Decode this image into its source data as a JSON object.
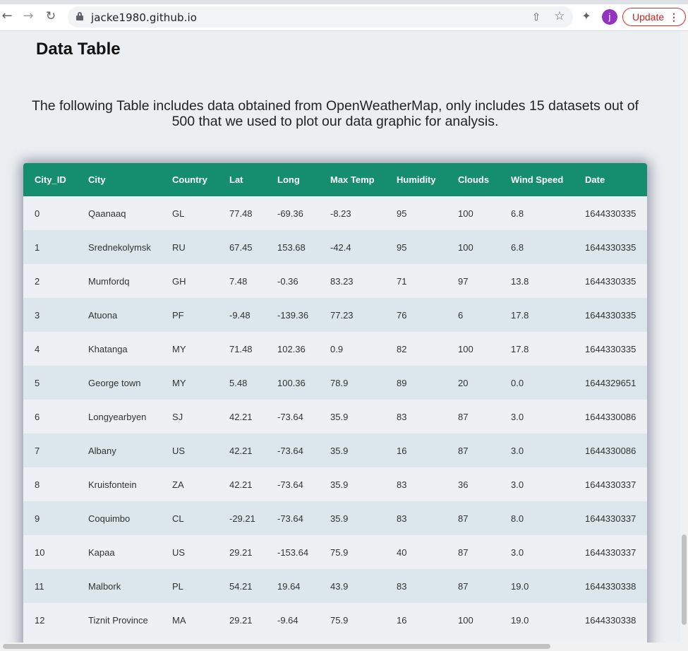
{
  "browser": {
    "url": "jacke1980.github.io",
    "update_label": "Update",
    "profile_initial": "j",
    "icons": {
      "back": "back-arrow-icon",
      "forward": "forward-arrow-icon",
      "reload": "reload-icon",
      "lock": "lock-icon",
      "share": "share-icon",
      "star": "star-icon",
      "extensions": "puzzle-icon",
      "menu": "kebab-menu-icon"
    }
  },
  "page": {
    "section_title": "Data Table",
    "intro_text": "The following Table includes data obtained from OpenWeatherMap, only includes 15 datasets out of 500 that we used to plot our data graphic for analysis."
  },
  "table": {
    "header_color": "#158e6f",
    "columns": [
      "City_ID",
      "City",
      "Country",
      "Lat",
      "Long",
      "Max Temp",
      "Humidity",
      "Clouds",
      "Wind Speed",
      "Date"
    ],
    "rows": [
      [
        "0",
        "Qaanaaq",
        "GL",
        "77.48",
        "-69.36",
        "-8.23",
        "95",
        "100",
        "6.8",
        "1644330335"
      ],
      [
        "1",
        "Srednekolymsk",
        "RU",
        "67.45",
        "153.68",
        "-42.4",
        "95",
        "100",
        "6.8",
        "1644330335"
      ],
      [
        "2",
        "Mumfordq",
        "GH",
        "7.48",
        "-0.36",
        "83.23",
        "71",
        "97",
        "13.8",
        "1644330335"
      ],
      [
        "3",
        "Atuona",
        "PF",
        "-9.48",
        "-139.36",
        "77.23",
        "76",
        "6",
        "17.8",
        "1644330335"
      ],
      [
        "4",
        "Khatanga",
        "MY",
        "71.48",
        "102.36",
        "0.9",
        "82",
        "100",
        "17.8",
        "1644330335"
      ],
      [
        "5",
        "George town",
        "MY",
        "5.48",
        "100.36",
        "78.9",
        "89",
        "20",
        "0.0",
        "1644329651"
      ],
      [
        "6",
        "Longyearbyen",
        "SJ",
        "42.21",
        "-73.64",
        "35.9",
        "83",
        "87",
        "3.0",
        "1644330086"
      ],
      [
        "7",
        "Albany",
        "US",
        "42.21",
        "-73.64",
        "35.9",
        "16",
        "87",
        "3.0",
        "1644330086"
      ],
      [
        "8",
        "Kruisfontein",
        "ZA",
        "42.21",
        "-73.64",
        "35.9",
        "83",
        "36",
        "3.0",
        "1644330337"
      ],
      [
        "9",
        "Coquimbo",
        "CL",
        "-29.21",
        "-73.64",
        "35.9",
        "83",
        "87",
        "8.0",
        "1644330337"
      ],
      [
        "10",
        "Kapaa",
        "US",
        "29.21",
        "-153.64",
        "75.9",
        "40",
        "87",
        "3.0",
        "1644330337"
      ],
      [
        "11",
        "Malbork",
        "PL",
        "54.21",
        "19.64",
        "43.9",
        "83",
        "87",
        "19.0",
        "1644330338"
      ],
      [
        "12",
        "Tiznit Province",
        "MA",
        "29.21",
        "-9.64",
        "75.9",
        "16",
        "100",
        "19.0",
        "1644330338"
      ]
    ]
  }
}
